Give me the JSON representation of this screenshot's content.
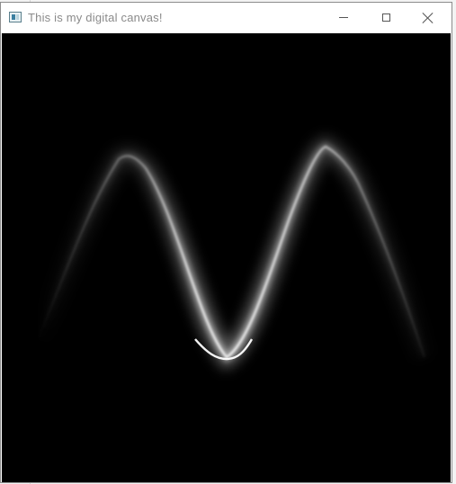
{
  "window": {
    "title": "This is my digital canvas!",
    "icon": "app-window-icon",
    "controls": {
      "minimize_icon": "minimize-icon",
      "maximize_icon": "maximize-icon",
      "close_icon": "close-icon"
    }
  },
  "canvas": {
    "background": "#000000",
    "stroke_color": "#ffffff",
    "content": "sinusoidal glowing curve"
  }
}
